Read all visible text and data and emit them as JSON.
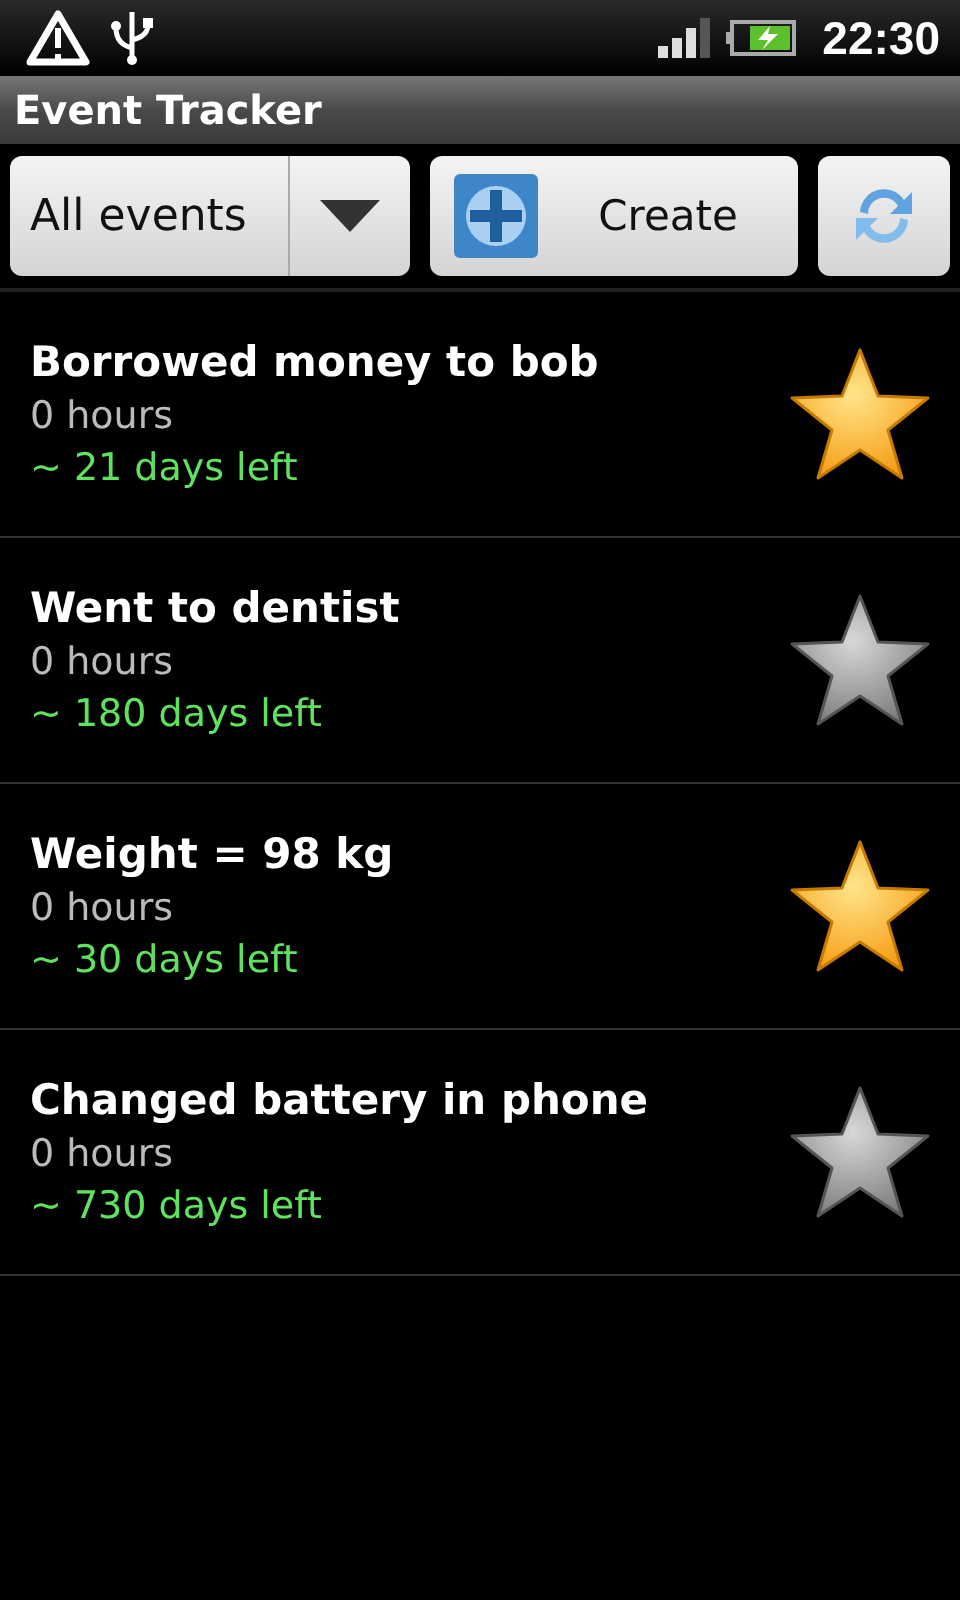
{
  "status_bar": {
    "time": "22:30"
  },
  "window": {
    "title": "Event Tracker"
  },
  "toolbar": {
    "filter": "All events",
    "create_label": "Create"
  },
  "events": [
    {
      "title": "Borrowed money to bob",
      "duration": "0 hours",
      "remaining": "~ 21 days left",
      "starred": true
    },
    {
      "title": "Went to dentist",
      "duration": "0 hours",
      "remaining": "~ 180 days left",
      "starred": false
    },
    {
      "title": "Weight = 98 kg",
      "duration": "0 hours",
      "remaining": "~ 30 days left",
      "starred": true
    },
    {
      "title": "Changed battery in phone",
      "duration": "0 hours",
      "remaining": "~ 730 days left",
      "starred": false
    }
  ]
}
